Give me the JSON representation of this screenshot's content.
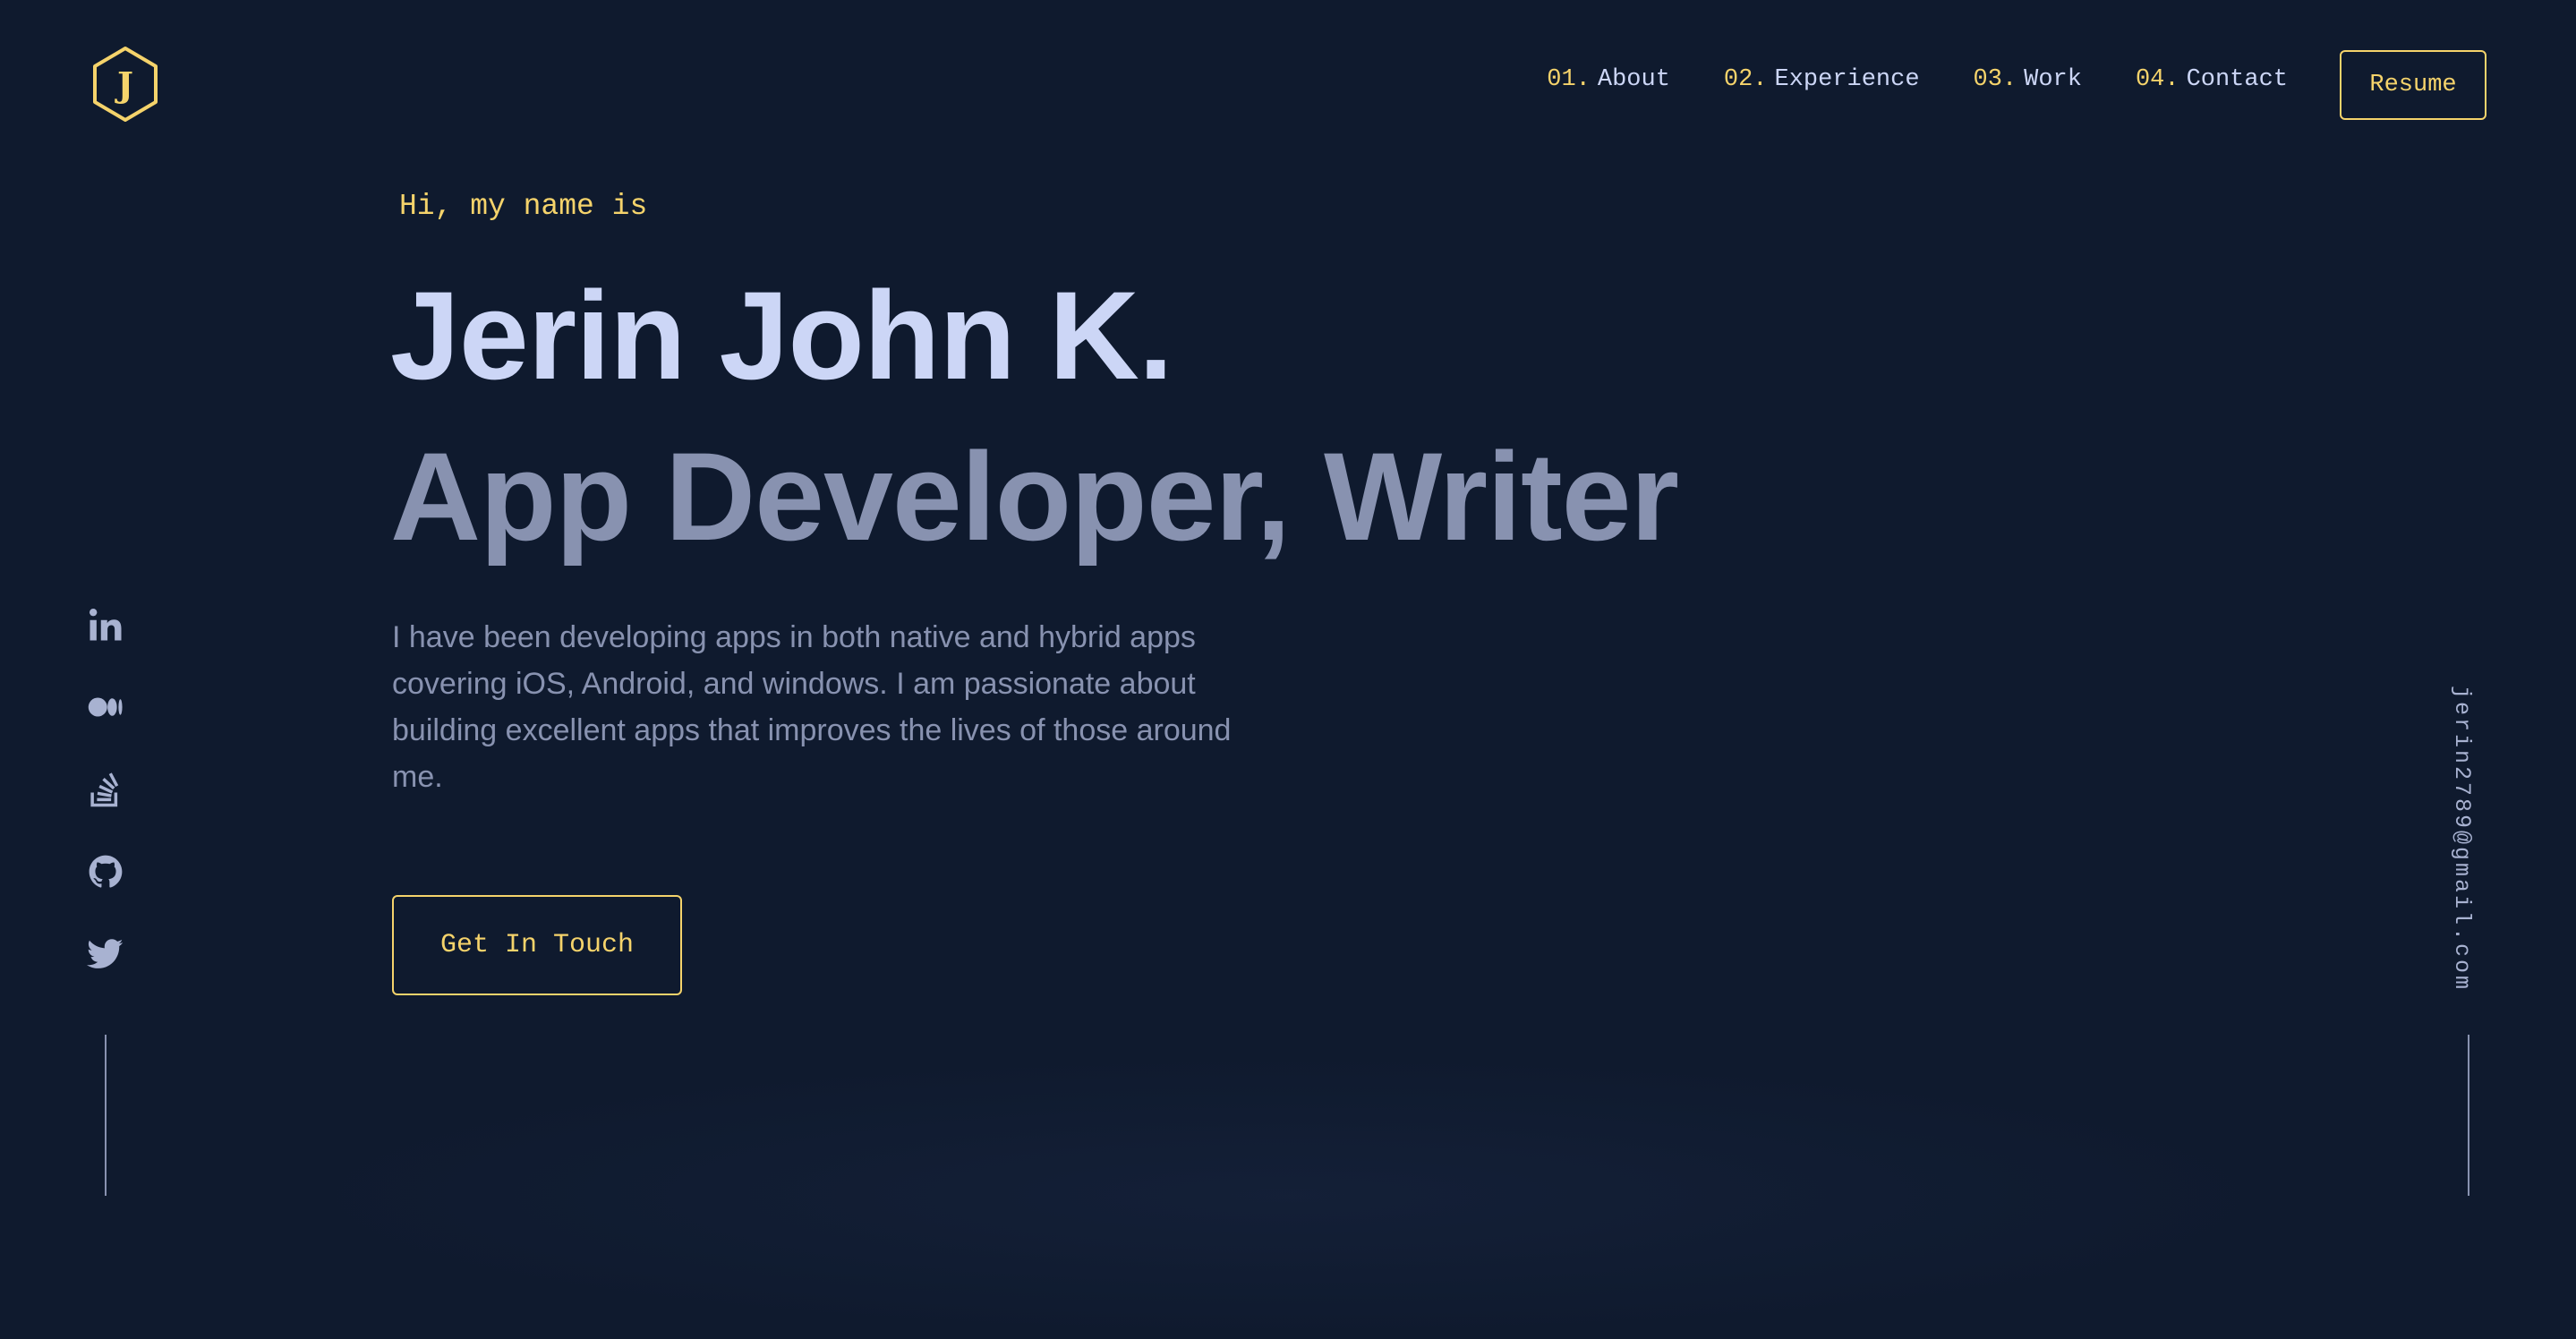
{
  "header": {
    "logo_letter": "J",
    "nav": [
      {
        "number": "01.",
        "label": "About"
      },
      {
        "number": "02.",
        "label": "Experience"
      },
      {
        "number": "03.",
        "label": "Work"
      },
      {
        "number": "04.",
        "label": "Contact"
      }
    ],
    "resume_label": "Resume"
  },
  "hero": {
    "greeting": "Hi, my name is",
    "name": "Jerin John K.",
    "role": "App Developer, Writer",
    "bio": "I have been developing apps in both native and hybrid apps covering iOS, Android, and windows. I am passionate about building excellent apps that improves the lives of those around me.",
    "cta_label": "Get In Touch"
  },
  "social": {
    "icons": [
      "linkedin-icon",
      "medium-icon",
      "stackoverflow-icon",
      "github-icon",
      "twitter-icon"
    ]
  },
  "email": "jerin2789@gmail.com",
  "colors": {
    "background": "#0f1a2e",
    "accent": "#f5d36b",
    "heading": "#ccd6f6",
    "muted": "#8892b0"
  }
}
